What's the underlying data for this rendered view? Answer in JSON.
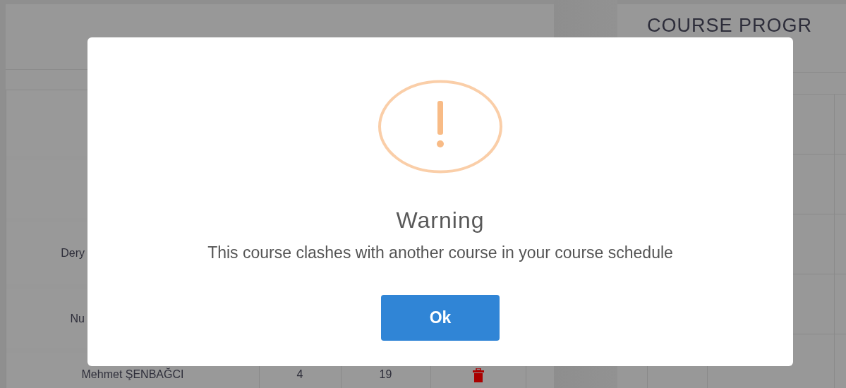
{
  "page": {
    "title": "COURSE PROGR",
    "rows": [
      {
        "name": "Dery"
      },
      {
        "name": "Nu"
      },
      {
        "name": "Mehmet ŞENBAĞCI",
        "credits": "4",
        "count": "19"
      }
    ]
  },
  "dialog": {
    "kind": "warning",
    "title": "Warning",
    "message": "This course clashes with another course in your course schedule",
    "buttons": [
      {
        "label": "Ok"
      }
    ]
  }
}
